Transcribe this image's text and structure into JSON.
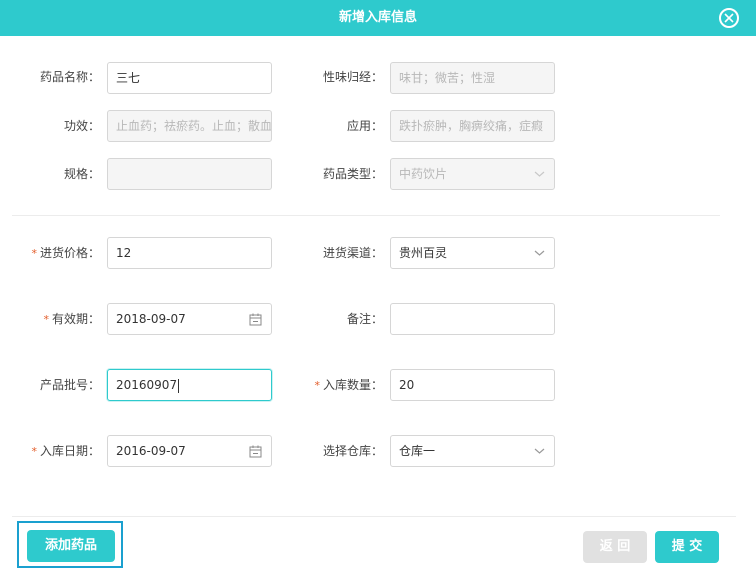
{
  "dialog": {
    "title": "新增入库信息"
  },
  "drug_info": {
    "name_label": "药品名称：",
    "name_value": "三七",
    "taste_label": "性味归经：",
    "taste_placeholder": "味甘；微苦；性湿",
    "effect_label": "功效：",
    "effect_placeholder": "止血药；祛瘀药。止血；散血",
    "usage_label": "应用：",
    "usage_placeholder": "跌扑瘀肿，胸痹绞痛，症瘕",
    "spec_label": "规格：",
    "spec_value": "",
    "type_label": "药品类型：",
    "type_value": "中药饮片"
  },
  "stock_info": {
    "price_label": "进货价格：",
    "price_value": "12",
    "channel_label": "进货渠道：",
    "channel_value": "贵州百灵",
    "expiry_label": "有效期：",
    "expiry_value": "2018-09-07",
    "remark_label": "备注：",
    "remark_value": "",
    "batch_label": "产品批号：",
    "batch_value": "20160907",
    "quantity_label": "入库数量：",
    "quantity_value": "20",
    "date_label": "入库日期：",
    "date_value": "2016-09-07",
    "warehouse_label": "选择仓库：",
    "warehouse_value": "仓库一"
  },
  "footer": {
    "add_label": "添加药品",
    "back_label": "返 回",
    "submit_label": "提 交"
  },
  "colors": {
    "accent": "#2ecacd",
    "required": "#e35d2a",
    "highlight": "#1aa0cf"
  }
}
